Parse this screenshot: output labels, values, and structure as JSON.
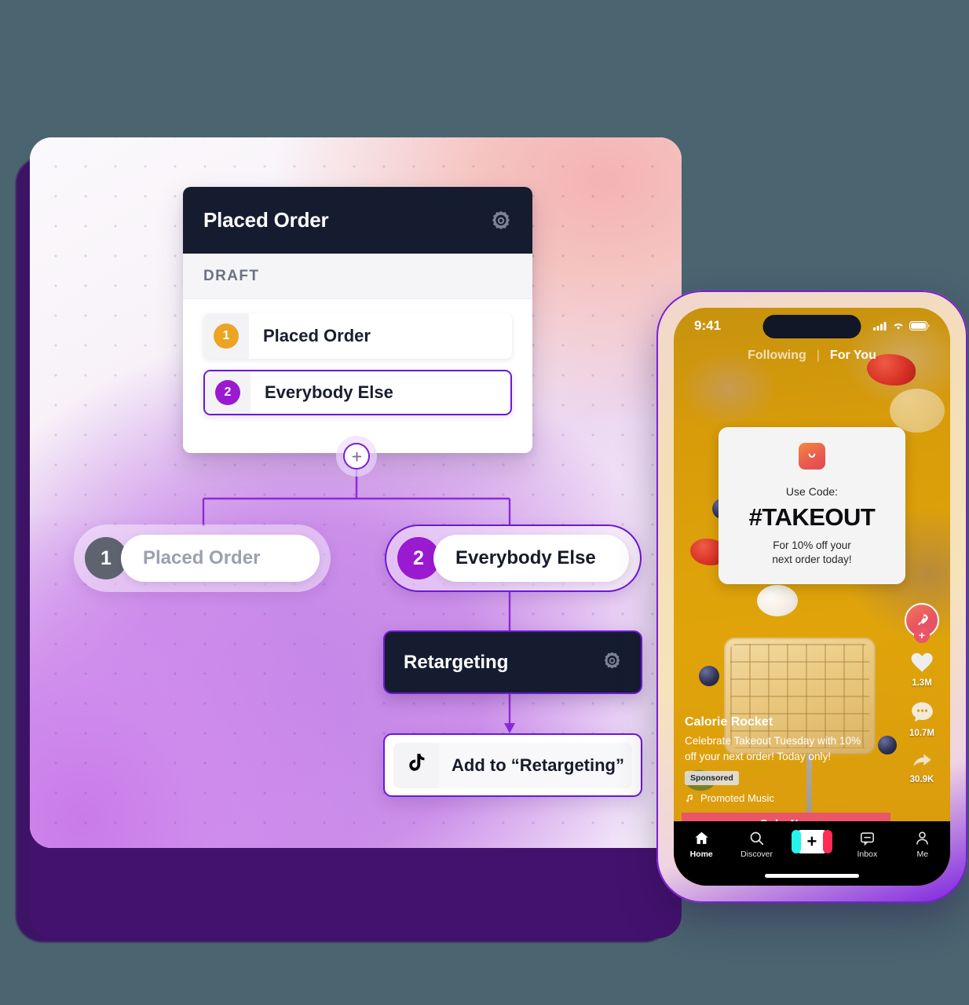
{
  "workflow_card": {
    "title": "Placed Order",
    "gear_icon": "gear-icon",
    "section_label": "DRAFT",
    "steps": [
      {
        "number": "1",
        "label": "Placed Order",
        "state": "plain"
      },
      {
        "number": "2",
        "label": "Everybody Else",
        "state": "active"
      }
    ]
  },
  "canvas": {
    "add_node_glyph": "+",
    "branches": [
      {
        "number": "1",
        "label": "Placed Order",
        "state": "inactive"
      },
      {
        "number": "2",
        "label": "Everybody Else",
        "state": "active"
      }
    ],
    "retargeting_node": {
      "title": "Retargeting",
      "gear_icon": "gear-icon"
    },
    "tiktok_node": {
      "icon": "tiktok-icon",
      "label": "Add to “Retargeting”"
    }
  },
  "phone": {
    "status_bar": {
      "time": "9:41",
      "signal_icon": "cellular-signal-icon",
      "wifi_icon": "wifi-icon",
      "battery_icon": "battery-icon"
    },
    "top_tabs": {
      "following": "Following",
      "divider": "|",
      "for_you": "For You"
    },
    "promo_card": {
      "logo_icon": "shopping-bag-icon",
      "use_code": "Use Code:",
      "code": "#TAKEOUT",
      "subtext_line1": "For 10% off your",
      "subtext_line2": "next order today!"
    },
    "caption": {
      "username": "Calorie Rocket",
      "text": "Celebrate Takeout Tuesday with 10% off your next order! Today only!",
      "sponsored_badge": "Sponsored",
      "music_icon": "music-note-icon",
      "music_label": "Promoted Music"
    },
    "cta_button": "Order Now",
    "action_rail": [
      {
        "icon": "rocket-avatar-icon",
        "badge": "+",
        "count": ""
      },
      {
        "icon": "heart-icon",
        "count": "1.3M"
      },
      {
        "icon": "comment-icon",
        "count": "10.7M"
      },
      {
        "icon": "share-arrow-icon",
        "count": "30.9K"
      }
    ],
    "bottom_nav": [
      {
        "icon": "home-icon",
        "label": "Home"
      },
      {
        "icon": "search-icon",
        "label": "Discover"
      },
      {
        "icon": "create-plus-icon",
        "label": ""
      },
      {
        "icon": "inbox-icon",
        "label": "Inbox"
      },
      {
        "icon": "person-icon",
        "label": "Me"
      }
    ]
  },
  "colors": {
    "background": "#4a6470",
    "accent_purple": "#6d18d6",
    "badge_orange": "#eba424",
    "badge_purple": "#9a1ad0",
    "badge_gray": "#5d6470",
    "dark_header": "#161c30",
    "cta_pink": "#ea5667",
    "phone_bg_amber": "#d9960a"
  }
}
